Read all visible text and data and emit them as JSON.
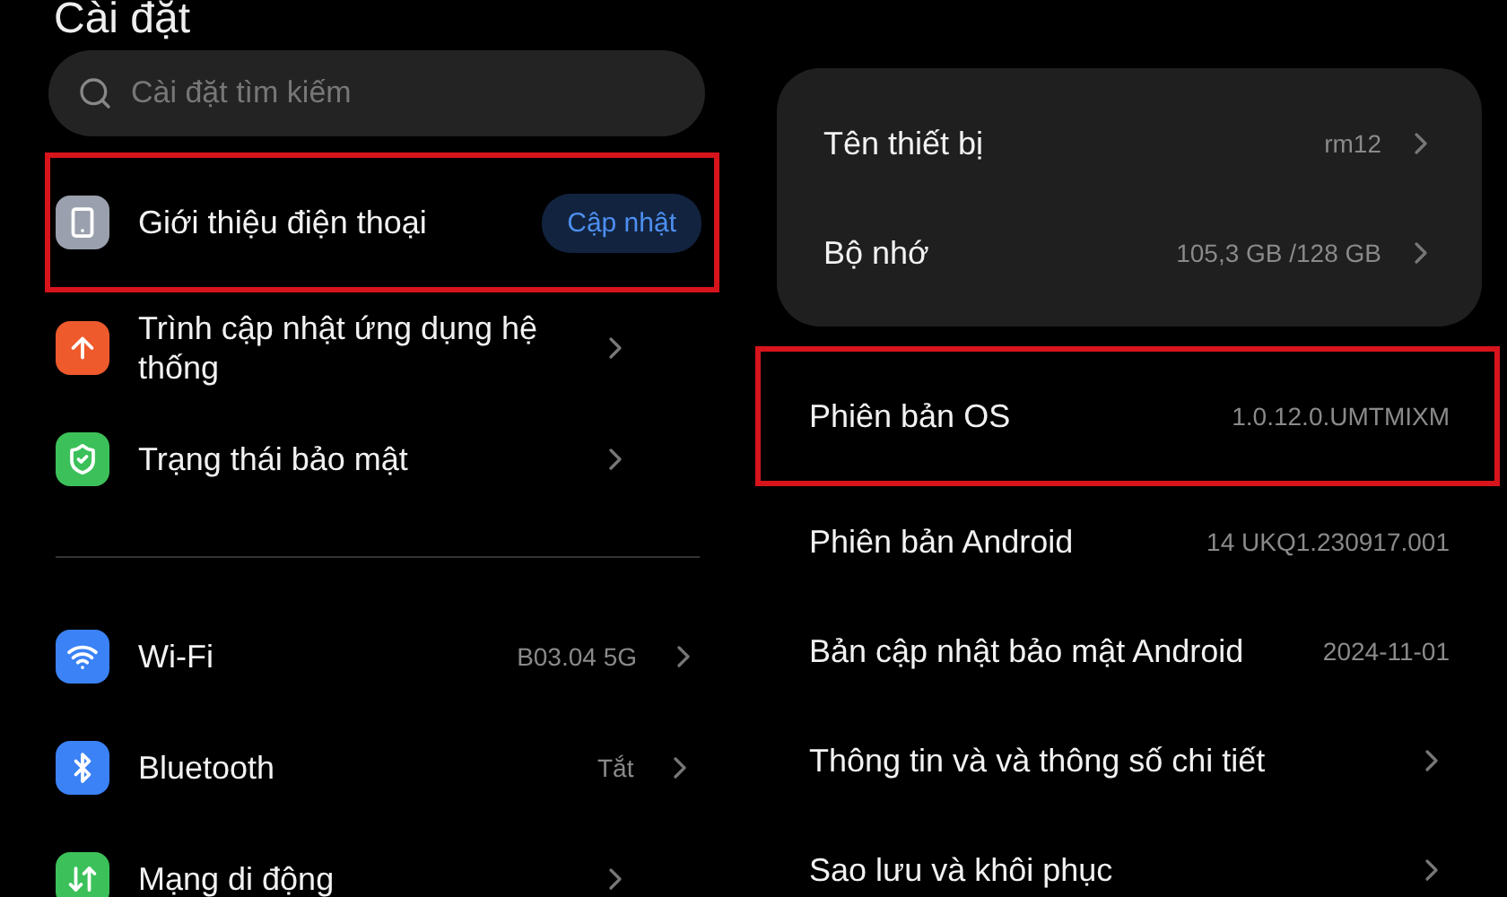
{
  "left": {
    "title": "Cài đặt",
    "search": {
      "placeholder": "Cài đặt tìm kiếm"
    },
    "groups": [
      {
        "items": [
          {
            "kind": "phone",
            "color": "#9aa0ad",
            "label": "Giới thiệu điện thoại",
            "badge": "Cập nhật",
            "highlighted": true,
            "chevron": false
          },
          {
            "kind": "update",
            "color": "#ee5a2c",
            "label": "Trình cập nhật ứng dụng hệ thống",
            "highlighted": false,
            "chevron": true
          },
          {
            "kind": "shield",
            "color": "#3cc15a",
            "label": "Trạng thái bảo mật",
            "highlighted": false,
            "chevron": true
          }
        ]
      },
      {
        "items": [
          {
            "kind": "wifi",
            "color": "#3b82f6",
            "label": "Wi-Fi",
            "value": "B03.04 5G",
            "highlighted": false,
            "chevron": true
          },
          {
            "kind": "bluetooth",
            "color": "#3b82f6",
            "label": "Bluetooth",
            "value": "Tắt",
            "highlighted": false,
            "chevron": true
          },
          {
            "kind": "mobile",
            "color": "#3cc15a",
            "label": "Mạng di động",
            "highlighted": false,
            "chevron": true
          }
        ]
      }
    ]
  },
  "right": {
    "card": [
      {
        "label": "Tên thiết bị",
        "value": "rm12",
        "chevron": true
      },
      {
        "label": "Bộ nhớ",
        "value": "105,3 GB /128 GB",
        "chevron": true
      }
    ],
    "rows": [
      {
        "label": "Phiên bản OS",
        "value": "1.0.12.0.UMTMIXM",
        "highlighted": true,
        "chevron": false
      },
      {
        "label": "Phiên bản Android",
        "value": "14 UKQ1.230917.001",
        "highlighted": false,
        "chevron": false
      },
      {
        "label": "Bản cập nhật bảo mật Android",
        "value": "2024-11-01",
        "highlighted": false,
        "chevron": false
      },
      {
        "label": "Thông tin và và thông số chi tiết",
        "highlighted": false,
        "chevron": true
      },
      {
        "label": "Sao lưu và khôi phục",
        "highlighted": false,
        "chevron": true
      }
    ]
  }
}
